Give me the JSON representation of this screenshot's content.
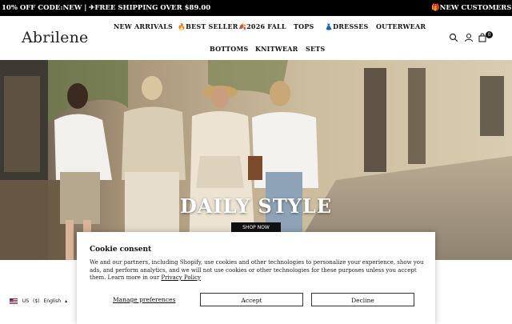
{
  "announcement": {
    "message_1": "10% OFF CODE:NEW | ✈FREE SHIPPING OVER $89.00",
    "message_2": "🎁NEW CUSTOMERS GET"
  },
  "header": {
    "logo": "Abrilene",
    "nav": [
      {
        "label": "NEW ARRIVALS",
        "icon": ""
      },
      {
        "label": "🔥BEST SELLER",
        "icon": "fire-icon"
      },
      {
        "label": "🍂2026 FALL",
        "icon": "leaf-icon"
      },
      {
        "label": "TOPS",
        "icon": ""
      },
      {
        "label": "👗DRESSES",
        "icon": "dress-icon"
      },
      {
        "label": "OUTERWEAR",
        "icon": ""
      },
      {
        "label": "BOTTOMS",
        "icon": ""
      },
      {
        "label": "KNITWEAR",
        "icon": ""
      },
      {
        "label": "SETS",
        "icon": ""
      }
    ],
    "icons": [
      "search-icon",
      "account-icon",
      "cart-icon"
    ],
    "cart_count": "0"
  },
  "hero": {
    "title": "DAILY STYLE",
    "button": "SHOP NOW"
  },
  "cookie": {
    "title": "Cookie consent",
    "text": "We and our partners, including Shopify, use cookies and other technologies to personalize your experience, show you ads, and perform analytics, and we will not use cookies or other technologies for these purposes unless you accept them. Learn more in our ",
    "link": "Privacy Policy",
    "manage": "Manage preferences",
    "accept": "Accept",
    "decline": "Decline"
  },
  "locale": {
    "country": "US",
    "currency": "($)",
    "language": "English"
  },
  "colors": {
    "announcement_bg": "#000000",
    "header_bg": "#ffffff",
    "button_dark": "#111111"
  }
}
